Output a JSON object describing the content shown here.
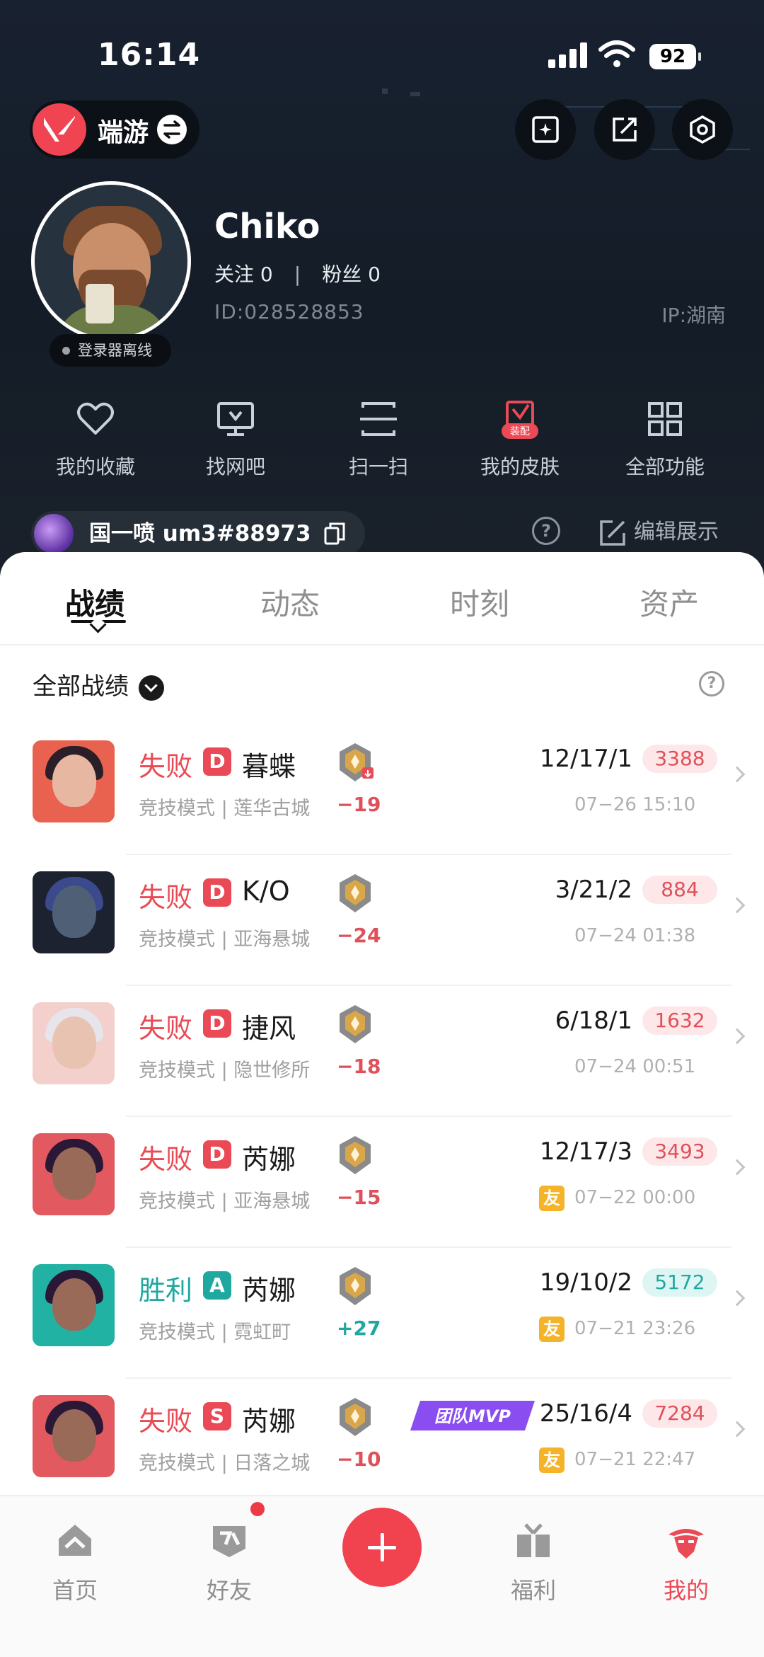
{
  "status_bar": {
    "time": "16:14",
    "battery": "92"
  },
  "header": {
    "game_label": "端游",
    "user": {
      "name": "Chiko",
      "follow_label": "关注",
      "follow_count": "0",
      "fans_label": "粉丝",
      "fans_count": "0",
      "id": "ID:028528853",
      "ip": "IP:湖南",
      "status": "登录器离线"
    },
    "quick_actions": [
      {
        "label": "我的收藏",
        "icon": "heart-icon"
      },
      {
        "label": "找网吧",
        "icon": "monitor-icon"
      },
      {
        "label": "扫一扫",
        "icon": "scan-icon"
      },
      {
        "label": "我的皮肤",
        "icon": "skin-icon",
        "badge": "装配"
      },
      {
        "label": "全部功能",
        "icon": "grid-icon"
      }
    ],
    "game_tag": "国一喷 um3#88973",
    "edit_display": "编辑展示"
  },
  "tabs": [
    "战绩",
    "动态",
    "时刻",
    "资产"
  ],
  "active_tab": "战绩",
  "filter_label": "全部战绩",
  "matches": [
    {
      "result": "失败",
      "outcome": "lose",
      "grade": "D",
      "agent": "暮蝶",
      "mode": "竞技模式 | 莲华古城",
      "rank_delta": "−19",
      "kda": "12/17/1",
      "score": "3388",
      "date": "07−26 15:10",
      "friend": false,
      "mvp": false
    },
    {
      "result": "失败",
      "outcome": "lose",
      "grade": "D",
      "agent": "K/O",
      "mode": "竞技模式 | 亚海悬城",
      "rank_delta": "−24",
      "kda": "3/21/2",
      "score": "884",
      "date": "07−24 01:38",
      "friend": false,
      "mvp": false
    },
    {
      "result": "失败",
      "outcome": "lose",
      "grade": "D",
      "agent": "捷风",
      "mode": "竞技模式 | 隐世修所",
      "rank_delta": "−18",
      "kda": "6/18/1",
      "score": "1632",
      "date": "07−24 00:51",
      "friend": false,
      "mvp": false
    },
    {
      "result": "失败",
      "outcome": "lose",
      "grade": "D",
      "agent": "芮娜",
      "mode": "竞技模式 | 亚海悬城",
      "rank_delta": "−15",
      "kda": "12/17/3",
      "score": "3493",
      "date": "07−22 00:00",
      "friend": true,
      "mvp": false
    },
    {
      "result": "胜利",
      "outcome": "win",
      "grade": "A",
      "agent": "芮娜",
      "mode": "竞技模式 | 霓虹町",
      "rank_delta": "+27",
      "kda": "19/10/2",
      "score": "5172",
      "date": "07−21 23:26",
      "friend": true,
      "mvp": false
    },
    {
      "result": "失败",
      "outcome": "lose",
      "grade": "S",
      "agent": "芮娜",
      "mode": "竞技模式 | 日落之城",
      "rank_delta": "−10",
      "kda": "25/16/4",
      "score": "7284",
      "date": "07−21 22:47",
      "friend": true,
      "mvp": true
    }
  ],
  "friend_badge": "友",
  "mvp_label": "团队MVP",
  "bottom_nav": [
    {
      "label": "首页",
      "icon": "home-icon"
    },
    {
      "label": "好友",
      "icon": "friends-icon"
    },
    {
      "label": "",
      "icon": "plus-icon"
    },
    {
      "label": "福利",
      "icon": "gift-icon"
    },
    {
      "label": "我的",
      "icon": "profile-icon"
    }
  ],
  "colors": {
    "accent": "#ea4a55",
    "win": "#1fa8a0",
    "header_bg": "#182130"
  }
}
